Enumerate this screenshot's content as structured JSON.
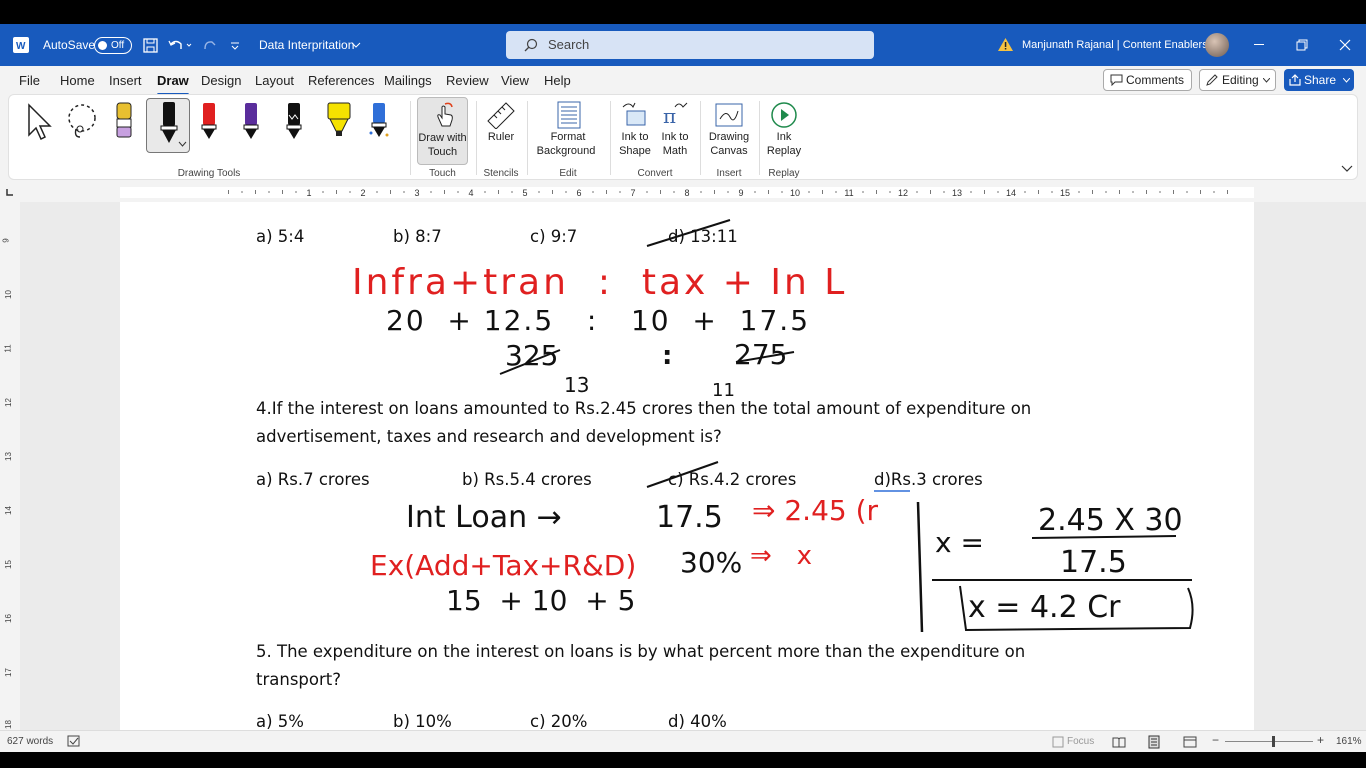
{
  "titlebar": {
    "autosave_label": "AutoSave",
    "autosave_state": "Off",
    "doc_title": "Data Interpritation",
    "search_placeholder": "Search",
    "user_name": "Manjunath Rajanal | Content Enablers"
  },
  "menu": {
    "items": [
      "File",
      "Home",
      "Insert",
      "Draw",
      "Design",
      "Layout",
      "References",
      "Mailings",
      "Review",
      "View",
      "Help"
    ],
    "active": "Draw",
    "comments_label": "Comments",
    "editing_label": "Editing",
    "share_label": "Share"
  },
  "ribbon": {
    "groups": {
      "drawing_tools": "Drawing Tools",
      "touch": "Touch",
      "stencils": "Stencils",
      "edit": "Edit",
      "convert": "Convert",
      "insert": "Insert",
      "replay": "Replay"
    },
    "buttons": {
      "draw_with_touch_1": "Draw with",
      "draw_with_touch_2": "Touch",
      "ruler": "Ruler",
      "format_bg_1": "Format",
      "format_bg_2": "Background",
      "ink_to_shape_1": "Ink to",
      "ink_to_shape_2": "Shape",
      "ink_to_math_1": "Ink to",
      "ink_to_math_2": "Math",
      "drawing_canvas_1": "Drawing",
      "drawing_canvas_2": "Canvas",
      "ink_replay_1": "Ink",
      "ink_replay_2": "Replay"
    },
    "pen_colors": [
      "#e8c030",
      "#111111",
      "#e02020",
      "#5a2d9c",
      "#111111",
      "#f5e200",
      "#2f6fd8"
    ]
  },
  "ruler_numbers": [
    "1",
    "2",
    "3",
    "4",
    "5",
    "6",
    "7",
    "8",
    "9",
    "10",
    "11",
    "12",
    "13",
    "14",
    "15"
  ],
  "vruler_numbers": [
    "9",
    "10",
    "11",
    "12",
    "13",
    "14",
    "15",
    "16",
    "17",
    "18"
  ],
  "document": {
    "q3_options": [
      "a) 5:4",
      "b) 8:7",
      "c) 9:7",
      "d) 13:11"
    ],
    "q4_line1": "4.If the interest on loans amounted to Rs.2.45 crores then the total amount of expenditure on",
    "q4_line2": "advertisement, taxes and research and development is?",
    "q4_options": [
      "a) Rs.7 crores",
      "b) Rs.5.4 crores",
      "c) Rs.4.2 crores",
      "d)Rs.3 crores"
    ],
    "q5_line1": "5. The expenditure on the interest on loans is by what percent more than the expenditure on",
    "q5_line2": "transport?",
    "q5_options": [
      "a) 5%",
      "b) 10%",
      "c) 20%",
      "d) 40%"
    ]
  },
  "ink_notes": {
    "red_line1": "Infra+tran  :  tax + In L",
    "black_line2": "20  + 12.5   :   10  +  17.5",
    "black_line3a": "325",
    "black_line3b": "275",
    "black_line4a": "13",
    "black_line4b": "11",
    "black_int": "Int Loan →",
    "black_175": "17.5",
    "red_245": "⇒ 2.45 (r",
    "red_ex": "Ex(Add+Tax+R&D)",
    "black_30": "30%",
    "red_x": "⇒   x",
    "black_sum": "15  + 10  + 5",
    "eq_top": "x =",
    "eq_num": "2.45 X 30",
    "eq_den": "17.5",
    "eq_result": "x = 4.2 Cr"
  },
  "status": {
    "words": "627 words",
    "focus": "Focus",
    "zoom": "161%"
  }
}
